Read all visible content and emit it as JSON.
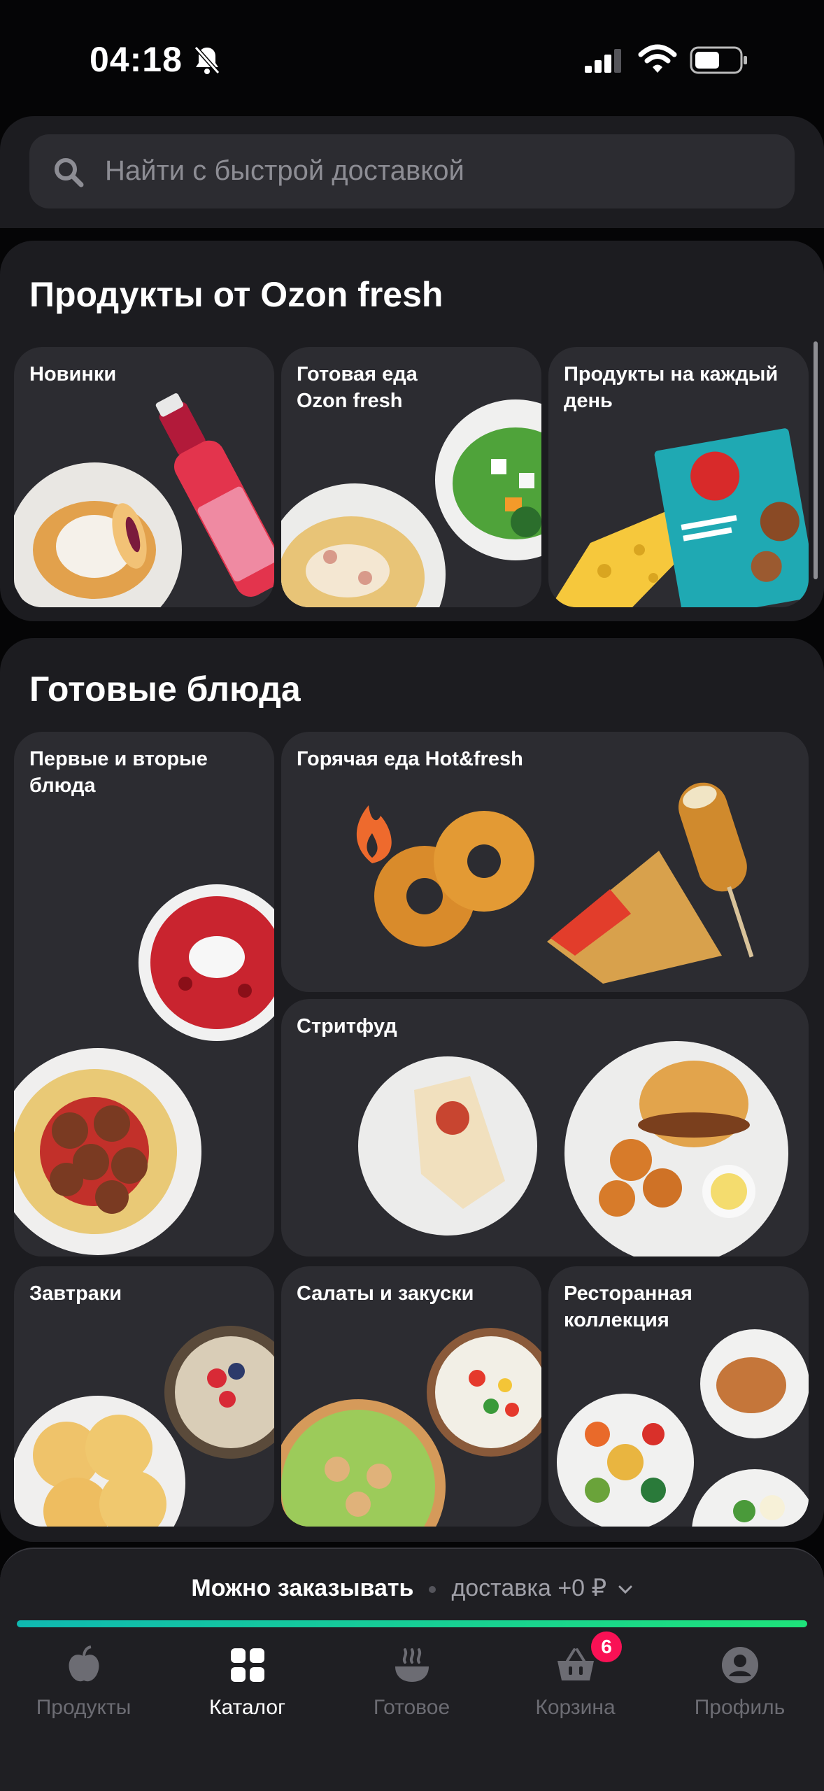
{
  "status_bar": {
    "time": "04:18",
    "icons": [
      "bell-slash-icon",
      "signal-icon",
      "wifi-icon",
      "battery-icon"
    ]
  },
  "search": {
    "placeholder": "Найти с быстрой доставкой",
    "icon": "search-icon"
  },
  "sections": [
    {
      "title": "Продукты от Ozon fresh",
      "cards": [
        {
          "label": "Новинки",
          "image": "bun-and-soda-bottle"
        },
        {
          "label": "Готовая еда\nOzon fresh",
          "image": "pasta-and-salad"
        },
        {
          "label": "Продукты на каждый\nдень",
          "image": "cheese-and-cereal-box"
        }
      ]
    },
    {
      "title": "Готовые блюда",
      "cards": [
        {
          "label": "Первые и вторые\nблюда",
          "image": "borscht-and-spaghetti"
        },
        {
          "label": "Горячая еда Hot&fresh",
          "image": "fire-donuts-sandwich-corndog"
        },
        {
          "label": "Стритфуд",
          "image": "shawarma-burger-potatoes"
        },
        {
          "label": "Завтраки",
          "image": "syrniki-and-oatmeal"
        },
        {
          "label": "Салаты и закуски",
          "image": "caesar-and-salad"
        },
        {
          "label": "Ресторанная\nколлекция",
          "image": "poke-bowl-and-dishes"
        }
      ]
    }
  ],
  "delivery": {
    "status": "Можно заказывать",
    "cost": "доставка +0 ₽",
    "progress": 1.0
  },
  "nav": [
    {
      "label": "Продукты",
      "icon": "apple-icon",
      "active": false
    },
    {
      "label": "Каталог",
      "icon": "grid-icon",
      "active": true
    },
    {
      "label": "Готовое",
      "icon": "hot-dish-icon",
      "active": false
    },
    {
      "label": "Корзина",
      "icon": "basket-icon",
      "active": false,
      "badge": "6"
    },
    {
      "label": "Профиль",
      "icon": "profile-icon",
      "active": false
    }
  ],
  "colors": {
    "accent_green": "#1ee27a",
    "badge_pink": "#f91155",
    "card_bg": "#2c2c31",
    "panel_bg": "#1c1c20"
  }
}
